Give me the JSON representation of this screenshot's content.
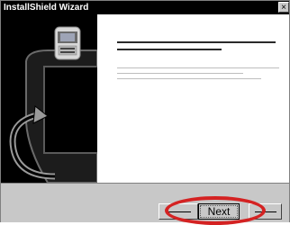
{
  "window": {
    "title": "InstallShield Wizard",
    "close_glyph": "×"
  },
  "buttons": {
    "back_label": "",
    "next_label": "Next",
    "cancel_label": ""
  },
  "colors": {
    "title_bar": "#000000",
    "art_background": "#000000",
    "content_background": "#ffffff",
    "dialog_background": "#c8c8c8",
    "highlight_ring": "#d42222"
  },
  "icons": {
    "art_icon": "computer-setup-icon",
    "art_graphic": "curved-arrow-icon"
  }
}
